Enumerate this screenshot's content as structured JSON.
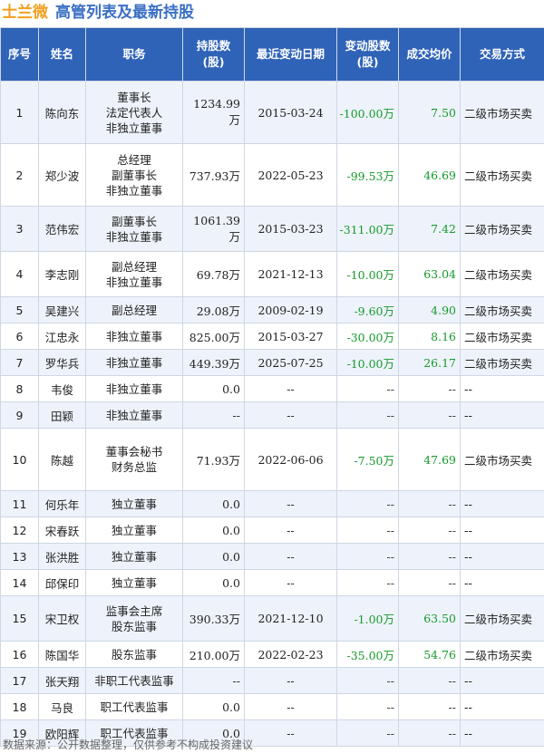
{
  "header": {
    "company": "士兰微",
    "subtitle": "高管列表及最新持股"
  },
  "table": {
    "columns": [
      "序号",
      "姓名",
      "职务",
      "持股数\n(股)",
      "最近变动日期",
      "变动股数\n(股)",
      "成交均价",
      "交易方式"
    ],
    "rows": [
      {
        "idx": "1",
        "name": "陈向东",
        "positions": [
          "董事长",
          "法定代表人",
          "非独立董事"
        ],
        "holding": "1234.99万",
        "date": "2015-03-24",
        "change": "-100.00万",
        "price": "7.50",
        "method": "二级市场买卖"
      },
      {
        "idx": "2",
        "name": "郑少波",
        "positions": [
          "总经理",
          "副董事长",
          "非独立董事"
        ],
        "holding": "737.93万",
        "date": "2022-05-23",
        "change": "-99.53万",
        "price": "46.69",
        "method": "二级市场买卖"
      },
      {
        "idx": "3",
        "name": "范伟宏",
        "positions": [
          "副董事长",
          "非独立董事"
        ],
        "holding": "1061.39万",
        "date": "2015-03-23",
        "change": "-311.00万",
        "price": "7.42",
        "method": "二级市场买卖"
      },
      {
        "idx": "4",
        "name": "李志刚",
        "positions": [
          "副总经理",
          "非独立董事"
        ],
        "holding": "69.78万",
        "date": "2021-12-13",
        "change": "-10.00万",
        "price": "63.04",
        "method": "二级市场买卖"
      },
      {
        "idx": "5",
        "name": "吴建兴",
        "positions": [
          "副总经理"
        ],
        "holding": "29.08万",
        "date": "2009-02-19",
        "change": "-9.60万",
        "price": "4.90",
        "method": "二级市场买卖"
      },
      {
        "idx": "6",
        "name": "江忠永",
        "positions": [
          "非独立董事"
        ],
        "holding": "825.00万",
        "date": "2015-03-27",
        "change": "-30.00万",
        "price": "8.16",
        "method": "二级市场买卖"
      },
      {
        "idx": "7",
        "name": "罗华兵",
        "positions": [
          "非独立董事"
        ],
        "holding": "449.39万",
        "date": "2025-07-25",
        "change": "-10.00万",
        "price": "26.17",
        "method": "二级市场买卖"
      },
      {
        "idx": "8",
        "name": "韦俊",
        "positions": [
          "非独立董事"
        ],
        "holding": "0.0",
        "date": "--",
        "change": "--",
        "price": "--",
        "method": "--"
      },
      {
        "idx": "9",
        "name": "田颖",
        "positions": [
          "非独立董事"
        ],
        "holding": "--",
        "date": "--",
        "change": "--",
        "price": "--",
        "method": "--"
      },
      {
        "idx": "10",
        "name": "陈越",
        "positions": [
          "董事会秘书",
          "财务总监"
        ],
        "holding": "71.93万",
        "date": "2022-06-06",
        "change": "-7.50万",
        "price": "47.69",
        "method": "二级市场买卖"
      },
      {
        "idx": "11",
        "name": "何乐年",
        "positions": [
          "独立董事"
        ],
        "holding": "0.0",
        "date": "--",
        "change": "--",
        "price": "--",
        "method": "--"
      },
      {
        "idx": "12",
        "name": "宋春跃",
        "positions": [
          "独立董事"
        ],
        "holding": "0.0",
        "date": "--",
        "change": "--",
        "price": "--",
        "method": "--"
      },
      {
        "idx": "13",
        "name": "张洪胜",
        "positions": [
          "独立董事"
        ],
        "holding": "0.0",
        "date": "--",
        "change": "--",
        "price": "--",
        "method": "--"
      },
      {
        "idx": "14",
        "name": "邱保印",
        "positions": [
          "独立董事"
        ],
        "holding": "0.0",
        "date": "--",
        "change": "--",
        "price": "--",
        "method": "--"
      },
      {
        "idx": "15",
        "name": "宋卫权",
        "positions": [
          "监事会主席",
          "股东监事"
        ],
        "holding": "390.33万",
        "date": "2021-12-10",
        "change": "-1.00万",
        "price": "63.50",
        "method": "二级市场买卖"
      },
      {
        "idx": "16",
        "name": "陈国华",
        "positions": [
          "股东监事"
        ],
        "holding": "210.00万",
        "date": "2022-02-23",
        "change": "-35.00万",
        "price": "54.76",
        "method": "二级市场买卖"
      },
      {
        "idx": "17",
        "name": "张天翔",
        "positions": [
          "非职工代表监事"
        ],
        "holding": "--",
        "date": "--",
        "change": "--",
        "price": "--",
        "method": "--"
      },
      {
        "idx": "18",
        "name": "马良",
        "positions": [
          "职工代表监事"
        ],
        "holding": "0.0",
        "date": "--",
        "change": "--",
        "price": "--",
        "method": "--"
      },
      {
        "idx": "19",
        "name": "欧阳辉",
        "positions": [
          "职工代表监事"
        ],
        "holding": "0.0",
        "date": "--",
        "change": "--",
        "price": "--",
        "method": "--"
      }
    ]
  },
  "footer": {
    "source": "数据来源：公开数据整理，仅供参考不构成投资建议"
  },
  "colors": {
    "header_bg": "#2f63b8",
    "stripe": "#eef3fb",
    "negative": "#159a2a",
    "company": "#f0a020",
    "subtitle": "#3a6fc4"
  }
}
